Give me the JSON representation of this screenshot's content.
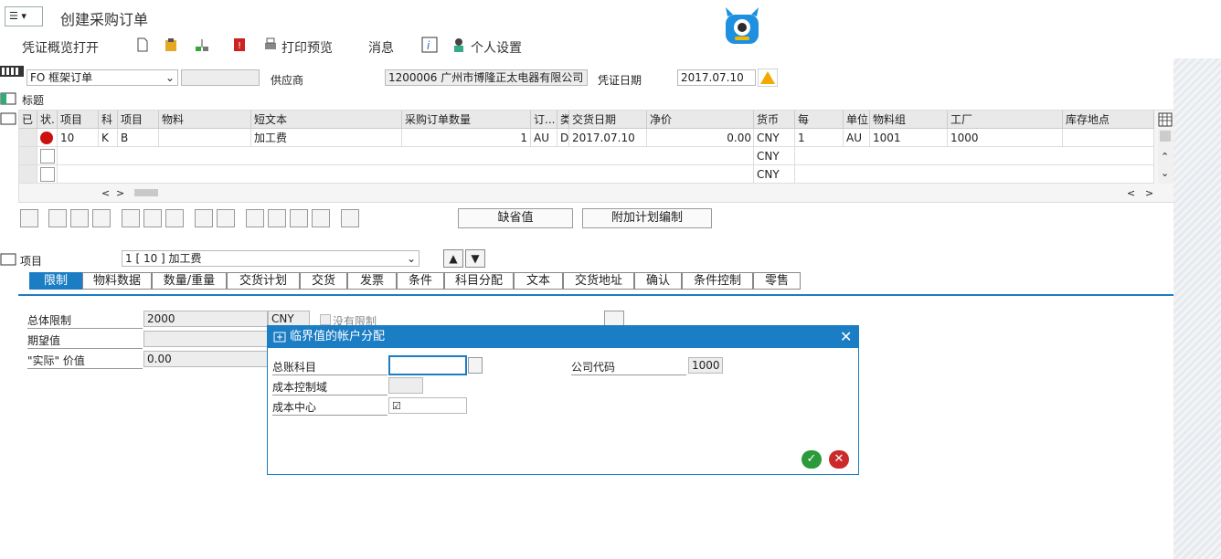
{
  "title": "创建采购订单",
  "toolbar": {
    "overview": "凭证概览打开",
    "print_preview": "打印预览",
    "messages": "消息",
    "personal_settings": "个人设置"
  },
  "header": {
    "order_type": "FO 框架订单",
    "vendor_label": "供应商",
    "vendor_value": "1200006 广州市博隆正太电器有限公司",
    "doc_date_label": "凭证日期",
    "doc_date_value": "2017.07.10",
    "header_label": "标题"
  },
  "grid": {
    "columns": [
      "已",
      "状.",
      "项目",
      "科",
      "项目",
      "物料",
      "短文本",
      "采购订单数量",
      "订...",
      "类",
      "交货日期",
      "净价",
      "货币",
      "每",
      "单位",
      "物料组",
      "工厂",
      "库存地点"
    ],
    "row1": {
      "item": "10",
      "acct": "K",
      "cat": "B",
      "short_text": "加工费",
      "qty": "1",
      "ou": "AU",
      "d": "D",
      "date": "2017.07.10",
      "price": "0.00",
      "curr": "CNY",
      "per": "1",
      "unit": "AU",
      "mat_group": "1001",
      "plant": "1000"
    },
    "row2_curr": "CNY",
    "row3_curr": "CNY"
  },
  "buttons": {
    "default_values": "缺省值",
    "add_planning": "附加计划编制"
  },
  "item_section": {
    "label": "项目",
    "value": "1 [ 10 ] 加工费"
  },
  "tabs": [
    "限制",
    "物料数据",
    "数量/重量",
    "交货计划",
    "交货",
    "发票",
    "条件",
    "科目分配",
    "文本",
    "交货地址",
    "确认",
    "条件控制",
    "零售"
  ],
  "limits": {
    "overall_label": "总体限制",
    "overall_value": "2000",
    "currency": "CNY",
    "no_limit": "没有限制",
    "expected_label": "期望值",
    "actual_label": "\"实际\" 价值",
    "actual_value": "0.00"
  },
  "dialog": {
    "title": "临界值的帐户分配",
    "gl_label": "总账科目",
    "company_label": "公司代码",
    "company_value": "1000",
    "controlling_label": "成本控制域",
    "cost_center_label": "成本中心"
  },
  "colors": {
    "accent": "#1b7dc4",
    "ok": "#2a9a3a",
    "cancel": "#cc2a2a"
  }
}
